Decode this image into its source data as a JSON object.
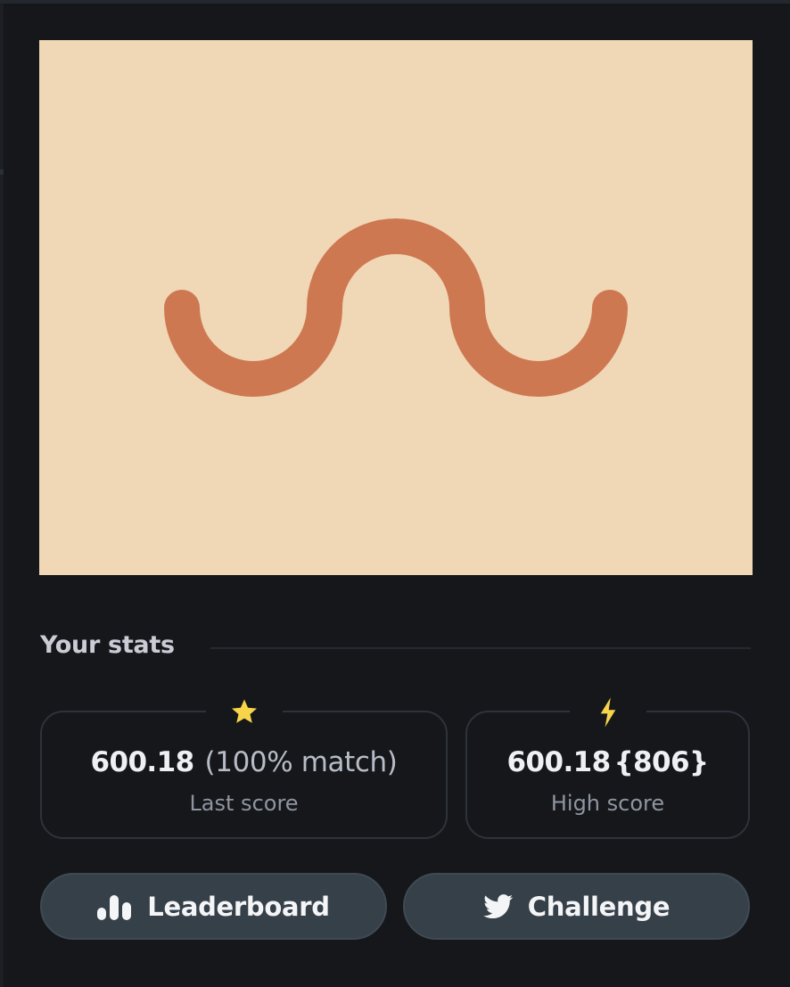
{
  "colors": {
    "background": "#15171b",
    "canvas": "#f0d7b6",
    "stroke": "#cd7851",
    "card_border": "#2e333a",
    "button": "#364049",
    "star": "#f7d449",
    "bolt": "#f7d449"
  },
  "stats": {
    "heading": "Your stats",
    "last": {
      "icon": "star-icon",
      "value": "600.18",
      "match": "(100% match)",
      "label": "Last score"
    },
    "high": {
      "icon": "lightning-icon",
      "value": "600.18",
      "rank": "{806}",
      "label": "High score"
    }
  },
  "buttons": {
    "leaderboard": {
      "icon": "bar-chart-icon",
      "label": "Leaderboard"
    },
    "challenge": {
      "icon": "twitter-icon",
      "label": "Challenge"
    }
  }
}
